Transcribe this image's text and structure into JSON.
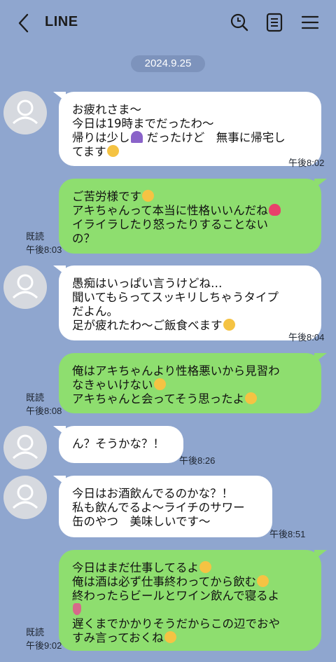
{
  "header": {
    "title": "LINE",
    "icons": [
      "back-chevron-icon",
      "search-icon",
      "notes-icon",
      "menu-icon"
    ]
  },
  "date_separator": "2024.9.25",
  "messages": [
    {
      "side": "in",
      "lines": [
        "お疲れさま〜",
        "今日は19時までだったわ〜",
        "帰りは少し",
        " だったけど　無事に帰宅し",
        "てます"
      ],
      "time": "午後8:02"
    },
    {
      "side": "out",
      "lines": [
        "ご苦労様です",
        "アキちゃんって本当に性格いいんだね",
        "イライラしたり怒ったりすることない",
        "の？"
      ],
      "time": "午後8:03",
      "read": "既読"
    },
    {
      "side": "in",
      "lines": [
        "愚痴はいっぱい言うけどね…",
        "聞いてもらってスッキリしちゃうタイプ",
        "だよん。",
        "足が疲れたわ〜ご飯食べます"
      ],
      "time": "午後8:04"
    },
    {
      "side": "out",
      "lines": [
        "俺はアキちゃんより性格悪いから見習わ",
        "なきゃいけない",
        "アキちゃんと会ってそう思ったよ"
      ],
      "time": "午後8:08",
      "read": "既読"
    },
    {
      "side": "in",
      "lines": [
        "ん？そうかな？！"
      ],
      "time": "午後8:26"
    },
    {
      "side": "in",
      "lines": [
        "今日はお酒飲んでるのかな？！",
        "私も飲んでるよ〜ライチのサワー",
        "缶のやつ　美味しいです〜"
      ],
      "time": "午後8:51"
    },
    {
      "side": "out",
      "lines": [
        "今日はまだ仕事してるよ",
        "俺は酒は必ず仕事終わってから飲む",
        "終わったらビールとワイン飲んで寝るよ",
        "",
        "遅くまでかかりそうだからこの辺でおや",
        "すみ言っておくね"
      ],
      "time": "午後9:02",
      "read": "既読"
    }
  ],
  "colors": {
    "background": "#8fa6cf",
    "incoming_bubble": "#ffffff",
    "outgoing_bubble": "#8ede6f",
    "date_pill": "#7d93bc"
  }
}
